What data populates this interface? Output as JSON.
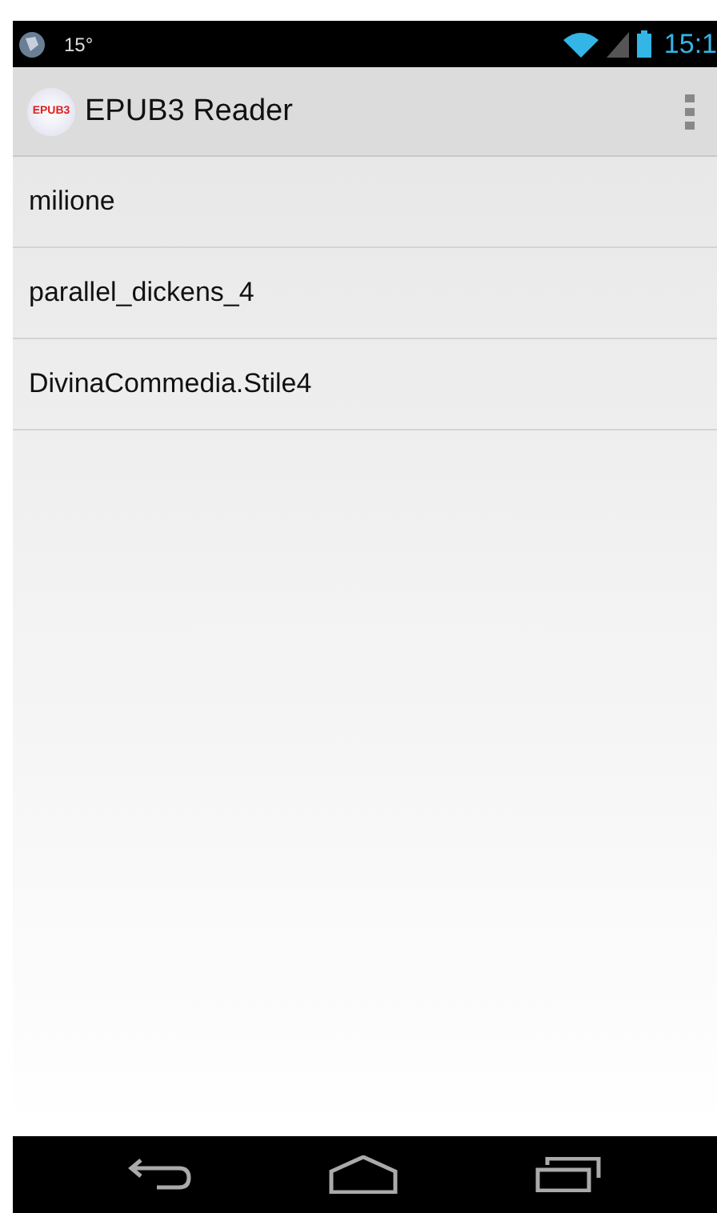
{
  "status_bar": {
    "temperature": "15°",
    "time": "15:1"
  },
  "action_bar": {
    "logo_text": "EPUB3",
    "title": "EPUB3 Reader"
  },
  "books": [
    {
      "title": "milione"
    },
    {
      "title": "parallel_dickens_4"
    },
    {
      "title": "DivinaCommedia.Stile4"
    }
  ]
}
